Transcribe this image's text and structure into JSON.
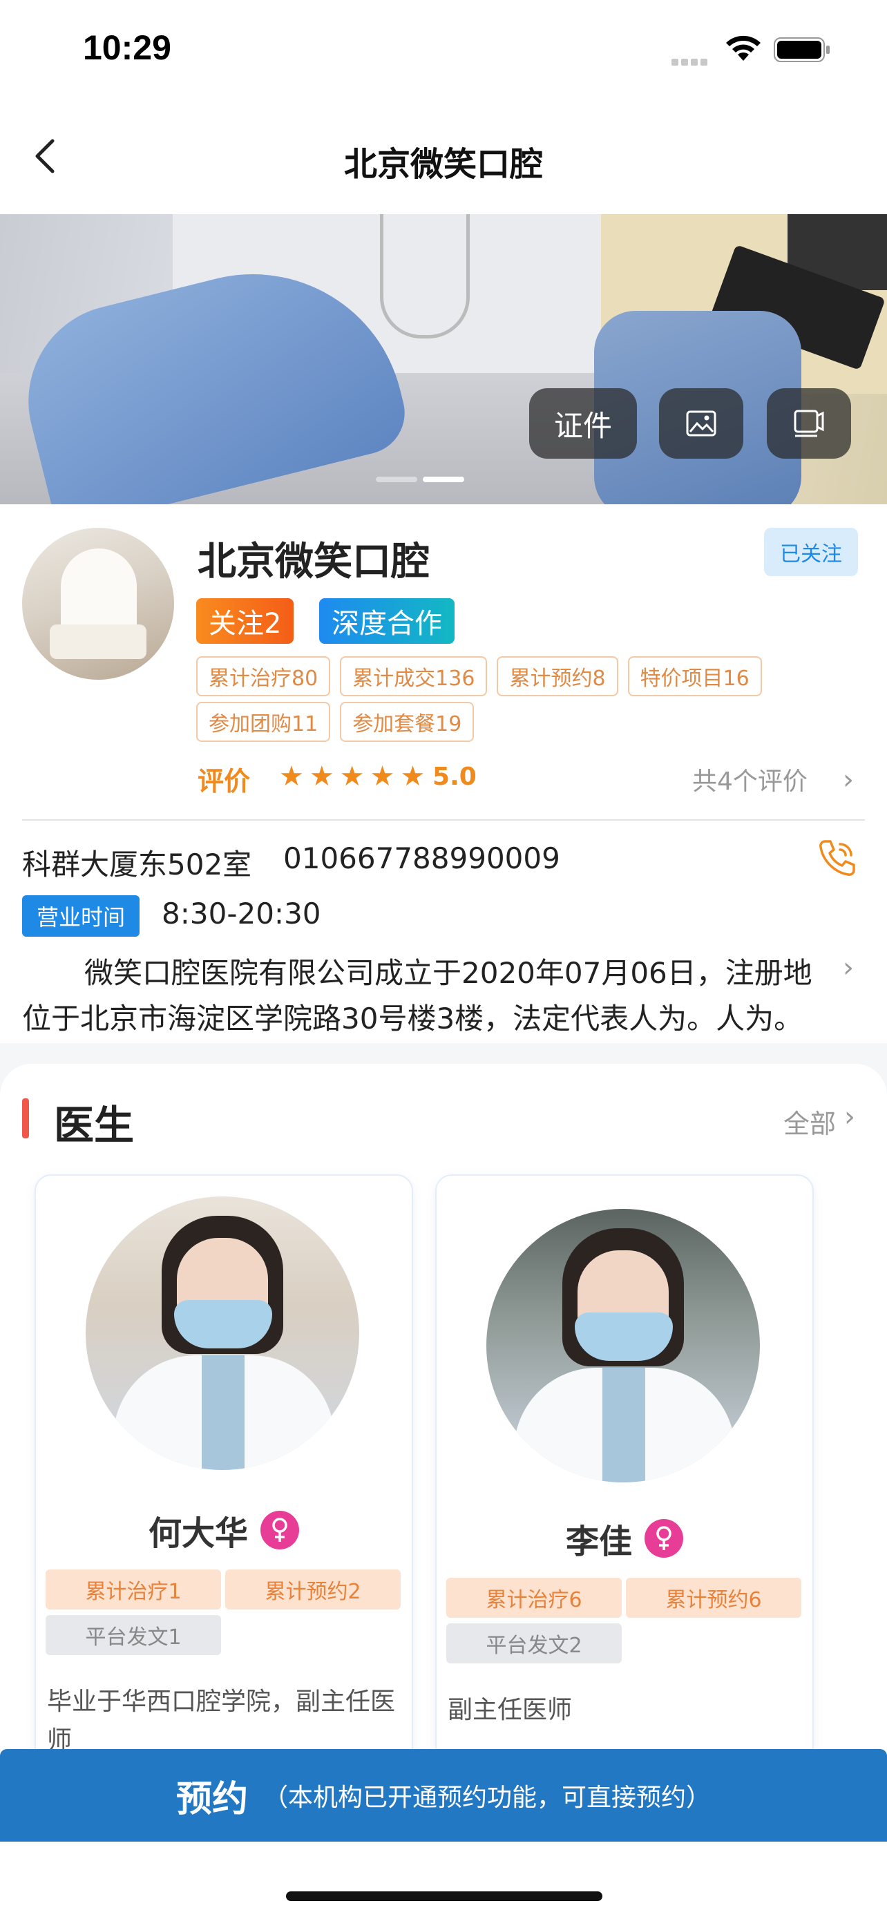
{
  "status_bar": {
    "time": "10:29"
  },
  "nav": {
    "title": "北京微笑口腔"
  },
  "hero": {
    "cert_label": "证件"
  },
  "clinic": {
    "name": "北京微笑口腔",
    "follow_status": "已关注",
    "badge_follow": "关注2",
    "badge_coop": "深度合作",
    "stats": [
      "累计治疗80",
      "累计成交136",
      "累计预约8",
      "特价项目16",
      "参加团购11",
      "参加套餐19"
    ],
    "rating_label": "评价",
    "rating_stars": 5,
    "rating_score": "5.0",
    "review_count": "共4个评价",
    "address": "科群大厦东502室",
    "phone": "010667788990009",
    "hours_label": "营业时间",
    "hours": "8:30-20:30",
    "intro": "微笑口腔医院有限公司成立于2020年07月06日，注册地位于北京市海淀区学院路30号楼3楼，法定代表人为。人为。"
  },
  "doctors_section": {
    "title": "医生",
    "all_label": "全部",
    "doctors": [
      {
        "name": "何大华",
        "tags": [
          "累计治疗1",
          "累计预约2"
        ],
        "posts": "平台发文1",
        "desc": "毕业于华西口腔学院，副主任医师"
      },
      {
        "name": "李佳",
        "tags": [
          "累计治疗6",
          "累计预约6"
        ],
        "posts": "平台发文2",
        "desc": "副主任医师"
      }
    ]
  },
  "booking": {
    "label": "预约",
    "note": "（本机构已开通预约功能，可直接预约）"
  },
  "colors": {
    "accent_blue": "#2378c4",
    "accent_orange": "#f08a1d",
    "female": "#e83d96"
  }
}
